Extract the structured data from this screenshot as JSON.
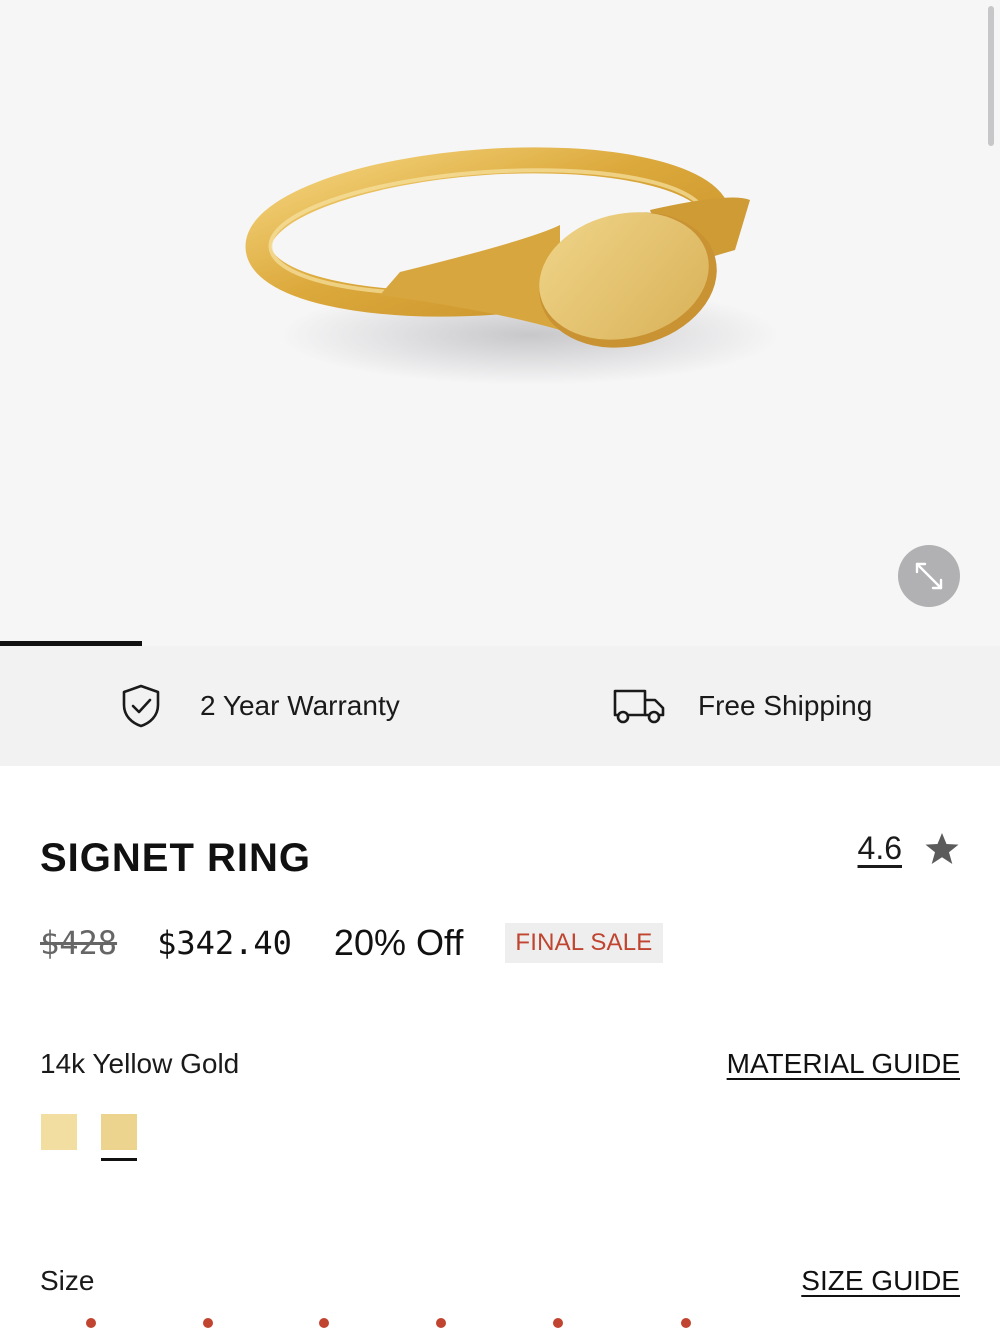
{
  "gallery": {
    "image_alt": "Signet ring in 14k yellow gold",
    "expand_icon": "expand-arrows-icon"
  },
  "benefits": {
    "warranty": {
      "icon": "shield-check-icon",
      "label": "2 Year Warranty"
    },
    "shipping": {
      "icon": "truck-icon",
      "label": "Free Shipping"
    }
  },
  "product": {
    "title": "SIGNET RING",
    "rating": "4.6",
    "rating_icon": "star-icon",
    "original_price": "$428",
    "sale_price": "$342.40",
    "discount": "20% Off",
    "badge": "FINAL SALE"
  },
  "material": {
    "selected_label": "14k Yellow Gold",
    "guide_link": "MATERIAL GUIDE",
    "swatches": [
      {
        "color": "#f1dea0",
        "selected": false
      },
      {
        "color": "#ecd48e",
        "selected": true
      }
    ]
  },
  "size": {
    "label": "Size",
    "guide_link": "SIZE GUIDE"
  },
  "colors": {
    "accent": "#c0442f",
    "gallery_bg": "#f6f6f7",
    "benefits_bg": "#f2f2f3",
    "gold": "#e2b54a"
  }
}
